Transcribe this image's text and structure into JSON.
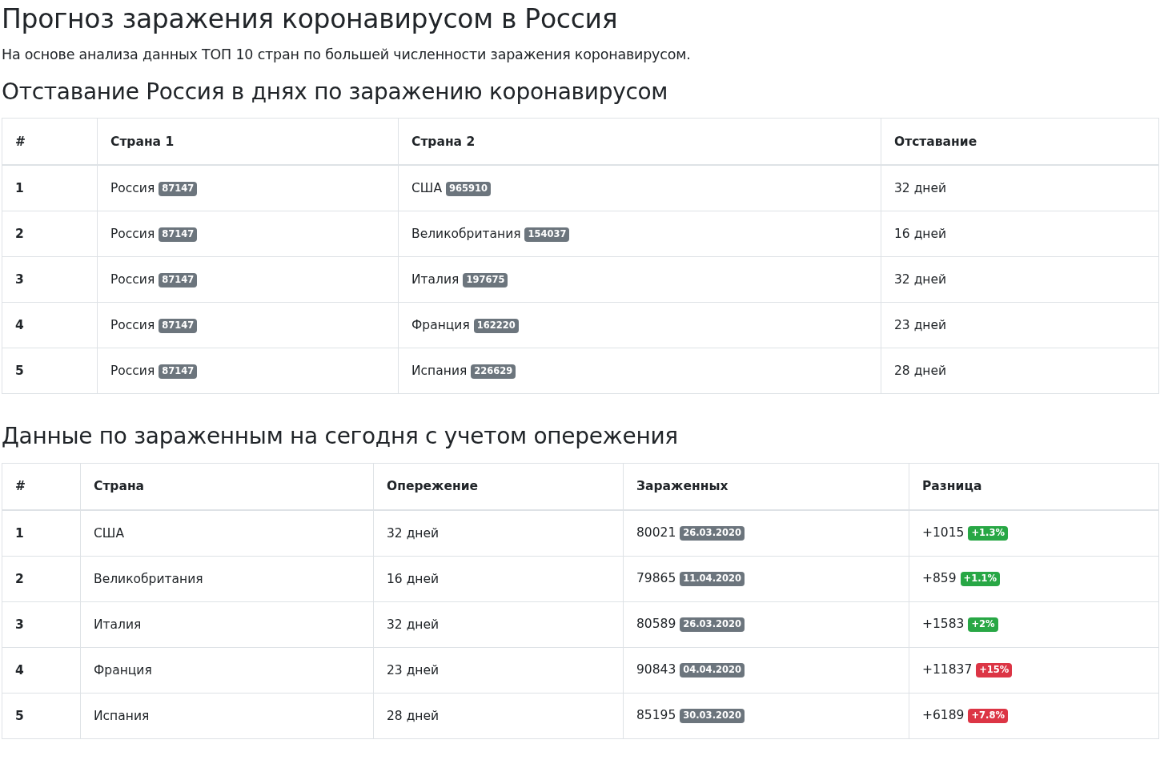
{
  "title": "Прогноз заражения коронавирусом в Россия",
  "subtitle": "На основе анализа данных ТОП 10 стран по большей численности заражения коронавирусом.",
  "lag_section": {
    "heading": "Отставание Россия в днях по заражению коронавирусом",
    "columns": [
      "#",
      "Страна 1",
      "Страна 2",
      "Отставание"
    ],
    "rows": [
      {
        "num": "1",
        "country1": "Россия",
        "count1": "87147",
        "country2": "США",
        "count2": "965910",
        "lag": "32 дней"
      },
      {
        "num": "2",
        "country1": "Россия",
        "count1": "87147",
        "country2": "Великобритания",
        "count2": "154037",
        "lag": "16 дней"
      },
      {
        "num": "3",
        "country1": "Россия",
        "count1": "87147",
        "country2": "Италия",
        "count2": "197675",
        "lag": "32 дней"
      },
      {
        "num": "4",
        "country1": "Россия",
        "count1": "87147",
        "country2": "Франция",
        "count2": "162220",
        "lag": "23 дней"
      },
      {
        "num": "5",
        "country1": "Россия",
        "count1": "87147",
        "country2": "Испания",
        "count2": "226629",
        "lag": "28 дней"
      }
    ]
  },
  "today_section": {
    "heading": "Данные по зараженным на сегодня с учетом опережения",
    "columns": [
      "#",
      "Страна",
      "Опережение",
      "Зараженных",
      "Разница"
    ],
    "rows": [
      {
        "num": "1",
        "country": "США",
        "lead": "32 дней",
        "infected": "80021",
        "date": "26.03.2020",
        "diff": "+1015",
        "diff_pct": "+1.3%",
        "color": "#28a745"
      },
      {
        "num": "2",
        "country": "Великобритания",
        "lead": "16 дней",
        "infected": "79865",
        "date": "11.04.2020",
        "diff": "+859",
        "diff_pct": "+1.1%",
        "color": "#28a745"
      },
      {
        "num": "3",
        "country": "Италия",
        "lead": "32 дней",
        "infected": "80589",
        "date": "26.03.2020",
        "diff": "+1583",
        "diff_pct": "+2%",
        "color": "#28a745"
      },
      {
        "num": "4",
        "country": "Франция",
        "lead": "23 дней",
        "infected": "90843",
        "date": "04.04.2020",
        "diff": "+11837",
        "diff_pct": "+15%",
        "color": "#dc3545"
      },
      {
        "num": "5",
        "country": "Испания",
        "lead": "28 дней",
        "infected": "85195",
        "date": "30.03.2020",
        "diff": "+6189",
        "diff_pct": "+7.8%",
        "color": "#dc3545"
      }
    ]
  }
}
